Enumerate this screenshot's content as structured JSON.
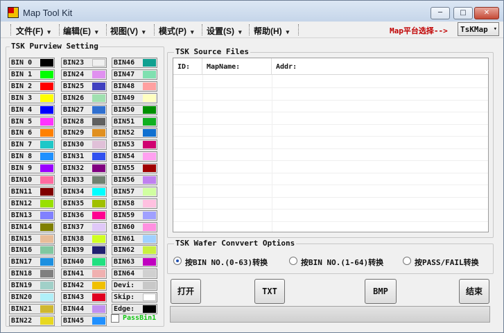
{
  "window": {
    "title": "Map Tool Kit",
    "min_glyph": "─",
    "max_glyph": "□",
    "close_glyph": "✕"
  },
  "menu": [
    {
      "label": "文件(F)"
    },
    {
      "label": "编辑(E)"
    },
    {
      "label": "视图(V)"
    },
    {
      "label": "模式(P)"
    },
    {
      "label": "设置(S)"
    },
    {
      "label": "帮助(H)"
    }
  ],
  "menu_arrow": "▾",
  "map_platform": {
    "label": "Map平台选择-->",
    "selected": "TsKMap",
    "arrow": "▾"
  },
  "purview": {
    "title": "TSK Purview Setting",
    "bins": [
      {
        "label": "BIN 0",
        "color": "#000000"
      },
      {
        "label": "BIN 1",
        "color": "#00ff00"
      },
      {
        "label": "BIN 2",
        "color": "#ff0000"
      },
      {
        "label": "BIN 3",
        "color": "#ffff00"
      },
      {
        "label": "BIN 4",
        "color": "#0000ff"
      },
      {
        "label": "BIN 5",
        "color": "#ff33ff"
      },
      {
        "label": "BIN 6",
        "color": "#ff8000"
      },
      {
        "label": "BIN 7",
        "color": "#1ec8c8"
      },
      {
        "label": "BIN 8",
        "color": "#1e90ff"
      },
      {
        "label": "BIN 9",
        "color": "#9a00ff"
      },
      {
        "label": "BIN10",
        "color": "#ff6aa0"
      },
      {
        "label": "BIN11",
        "color": "#800000"
      },
      {
        "label": "BIN12",
        "color": "#99e000"
      },
      {
        "label": "BIN13",
        "color": "#8080ff"
      },
      {
        "label": "BIN14",
        "color": "#808000"
      },
      {
        "label": "BIN15",
        "color": "#e8bc98"
      },
      {
        "label": "BIN16",
        "color": "#80c8a0"
      },
      {
        "label": "BIN17",
        "color": "#1e90e0"
      },
      {
        "label": "BIN18",
        "color": "#808080"
      },
      {
        "label": "BIN19",
        "color": "#a0d0c8"
      },
      {
        "label": "BIN20",
        "color": "#b0f0f8"
      },
      {
        "label": "BIN21",
        "color": "#d0b830"
      },
      {
        "label": "BIN22",
        "color": "#e8d820"
      },
      {
        "label": "BIN23",
        "color": "#f0f0f0"
      },
      {
        "label": "BIN24",
        "color": "#e090f0"
      },
      {
        "label": "BIN25",
        "color": "#4040c0"
      },
      {
        "label": "BIN26",
        "color": "#a0e0b0"
      },
      {
        "label": "BIN27",
        "color": "#3070d0"
      },
      {
        "label": "BIN28",
        "color": "#606060"
      },
      {
        "label": "BIN29",
        "color": "#e09020"
      },
      {
        "label": "BIN30",
        "color": "#e0c0d8"
      },
      {
        "label": "BIN31",
        "color": "#3050f0"
      },
      {
        "label": "BIN32",
        "color": "#800080"
      },
      {
        "label": "BIN33",
        "color": "#708070"
      },
      {
        "label": "BIN34",
        "color": "#00ffff"
      },
      {
        "label": "BIN35",
        "color": "#a0c000"
      },
      {
        "label": "BIN36",
        "color": "#ff0090"
      },
      {
        "label": "BIN37",
        "color": "#e0c8f8"
      },
      {
        "label": "BIN38",
        "color": "#d0ff20"
      },
      {
        "label": "BIN39",
        "color": "#202070"
      },
      {
        "label": "BIN40",
        "color": "#20e080"
      },
      {
        "label": "BIN41",
        "color": "#f0b0b0"
      },
      {
        "label": "BIN42",
        "color": "#f0c000"
      },
      {
        "label": "BIN43",
        "color": "#e00020"
      },
      {
        "label": "BIN44",
        "color": "#c090f0"
      },
      {
        "label": "BIN45",
        "color": "#2090ff"
      },
      {
        "label": "BIN46",
        "color": "#10a090"
      },
      {
        "label": "BIN47",
        "color": "#80e0b0"
      },
      {
        "label": "BIN48",
        "color": "#ffa0a0"
      },
      {
        "label": "BIN49",
        "color": "#ffffc0"
      },
      {
        "label": "BIN50",
        "color": "#009000"
      },
      {
        "label": "BIN51",
        "color": "#10b020"
      },
      {
        "label": "BIN52",
        "color": "#1070d0"
      },
      {
        "label": "BIN53",
        "color": "#d00070"
      },
      {
        "label": "BIN54",
        "color": "#ffa0f0"
      },
      {
        "label": "BIN55",
        "color": "#a00000"
      },
      {
        "label": "BIN56",
        "color": "#c080f0"
      },
      {
        "label": "BIN57",
        "color": "#d0ffa0"
      },
      {
        "label": "BIN58",
        "color": "#ffc0e0"
      },
      {
        "label": "BIN59",
        "color": "#a0a0ff"
      },
      {
        "label": "BIN60",
        "color": "#ff90e0"
      },
      {
        "label": "BIN61",
        "color": "#a0d0ff"
      },
      {
        "label": "BIN62",
        "color": "#c8f040"
      },
      {
        "label": "BIN63",
        "color": "#c000c0"
      },
      {
        "label": "BIN64",
        "color": "#d0d0d0"
      },
      {
        "label": "Devi:",
        "color": "#c8c8c8"
      },
      {
        "label": "Skip:",
        "color": "#ffffff"
      },
      {
        "label": "Edge:",
        "color": "#000000"
      }
    ],
    "pass_bin_label": "PassBin1"
  },
  "source_files": {
    "title": "TSK Source Files",
    "columns": [
      "ID:",
      "MapName:",
      "Addr:"
    ]
  },
  "options": {
    "title": "TSK Wafer Convvert Options",
    "radios": [
      {
        "label": "按BIN NO.(0-63)转换",
        "selected": true
      },
      {
        "label": "按BIN NO.(1-64)转换",
        "selected": false
      },
      {
        "label": "按PASS/FAIL转换",
        "selected": false
      }
    ]
  },
  "buttons": {
    "open": "打开",
    "txt": "TXT",
    "bmp": "BMP",
    "finish": "结束"
  }
}
